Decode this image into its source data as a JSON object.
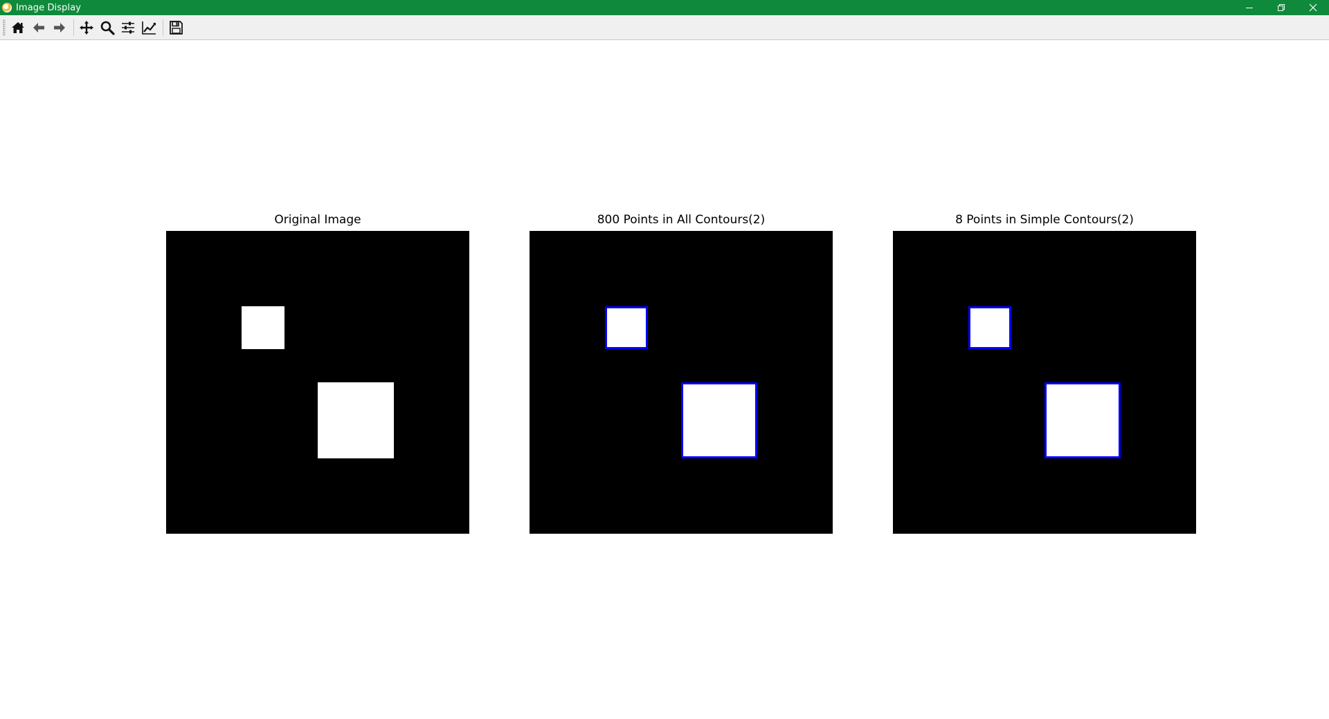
{
  "window": {
    "title": "Image Display",
    "controls": [
      "minimize-icon",
      "restore-icon",
      "close-icon"
    ]
  },
  "toolbar": {
    "buttons": [
      {
        "icon": "home-icon",
        "label": "Home"
      },
      {
        "icon": "back-arrow-icon",
        "label": "Back"
      },
      {
        "icon": "forward-arrow-icon",
        "label": "Forward"
      },
      {
        "icon": "pan-icon",
        "label": "Pan"
      },
      {
        "icon": "zoom-icon",
        "label": "Zoom"
      },
      {
        "icon": "subplots-icon",
        "label": "Configure subplots"
      },
      {
        "icon": "edit-axis-icon",
        "label": "Edit axis"
      },
      {
        "icon": "save-icon",
        "label": "Save"
      }
    ]
  },
  "figure": {
    "panels": [
      {
        "title": "Original Image",
        "image": "binary-squares",
        "contours": false
      },
      {
        "title": "800 Points in All Contours(2)",
        "image": "binary-squares",
        "contours": true
      },
      {
        "title": "8 Points in Simple Contours(2)",
        "image": "binary-squares",
        "contours": true
      }
    ],
    "colors": {
      "titlebar": "#0f8a3c",
      "image_background": "#000000",
      "square_fill": "#ffffff",
      "contour": "#0000ff"
    }
  }
}
